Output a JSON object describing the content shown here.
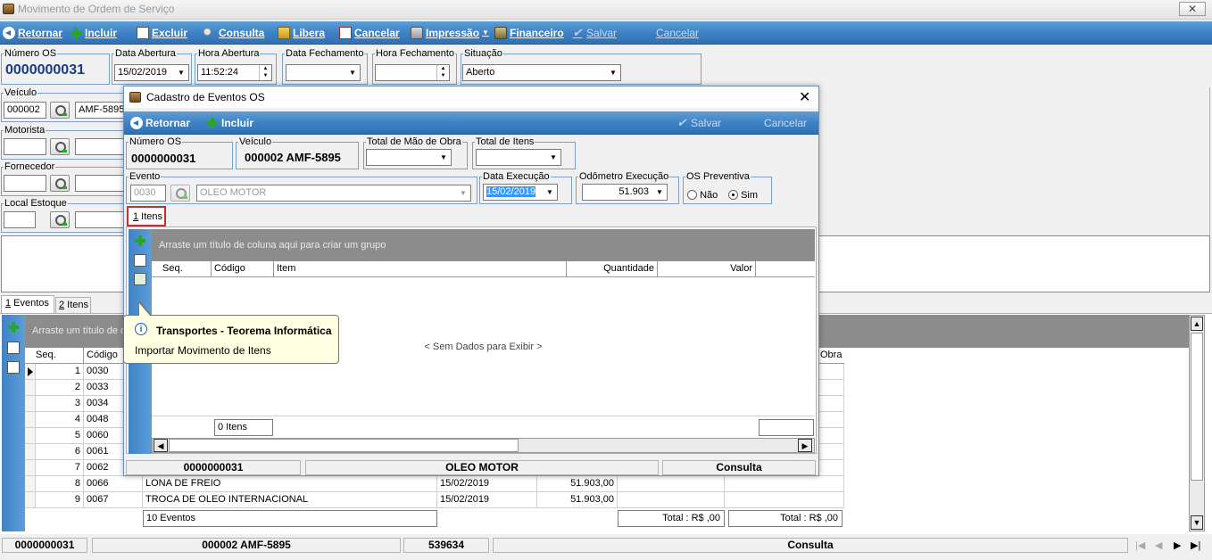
{
  "main_window": {
    "title": "Movimento de Ordem de Serviço",
    "close": "✕",
    "toolbar": {
      "retornar": "Retornar",
      "incluir": "Incluir",
      "excluir": "Excluir",
      "consulta": "Consulta",
      "libera": "Libera",
      "cancelar": "Cancelar",
      "impressao": "Impressão",
      "financeiro": "Financeiro",
      "salvar": "Salvar",
      "cancelar2": "Cancelar"
    },
    "fields": {
      "numero_os_label": "Número OS",
      "numero_os": "0000000031",
      "data_abertura_label": "Data Abertura",
      "data_abertura": "15/02/2019",
      "hora_abertura_label": "Hora Abertura",
      "hora_abertura": "11:52:24",
      "data_fechamento_label": "Data Fechamento",
      "data_fechamento": "",
      "hora_fechamento_label": "Hora Fechamento",
      "hora_fechamento": "",
      "situacao_label": "Situação",
      "situacao": "Aberto",
      "veiculo_label": "Veículo",
      "veiculo_codigo": "000002",
      "veiculo_placa": "AMF-5895",
      "motorista_label": "Motorista",
      "fornecedor_label": "Fornecedor",
      "local_estoque_label": "Local Estoque"
    },
    "tabs": [
      {
        "num": "1",
        "label": " Eventos"
      },
      {
        "num": "2",
        "label": " Itens"
      }
    ],
    "grid": {
      "group_hint": "Arraste um título de c",
      "columns": [
        "Seq.",
        "Código",
        "Obra"
      ],
      "rows": [
        {
          "seq": "1",
          "codigo": "0030",
          "desc": "",
          "data": "",
          "valor": ""
        },
        {
          "seq": "2",
          "codigo": "0033",
          "desc": "",
          "data": "",
          "valor": ""
        },
        {
          "seq": "3",
          "codigo": "0034",
          "desc": "",
          "data": "",
          "valor": ""
        },
        {
          "seq": "4",
          "codigo": "0048",
          "desc": "",
          "data": "",
          "valor": ""
        },
        {
          "seq": "5",
          "codigo": "0060",
          "desc": "",
          "data": "",
          "valor": ""
        },
        {
          "seq": "6",
          "codigo": "0061",
          "desc": "",
          "data": "",
          "valor": ""
        },
        {
          "seq": "7",
          "codigo": "0062",
          "desc": "",
          "data": "",
          "valor": ""
        },
        {
          "seq": "8",
          "codigo": "0066",
          "desc": "LONA DE FREIO",
          "data": "15/02/2019",
          "valor": "51.903,00"
        },
        {
          "seq": "9",
          "codigo": "0067",
          "desc": "TROCA DE OLEO INTERNACIONAL",
          "data": "15/02/2019",
          "valor": "51.903,00"
        }
      ],
      "footer_count": "10 Eventos",
      "footer_total1": "Total : R$ ,00",
      "footer_total2": "Total : R$ ,00"
    },
    "statusbar": {
      "numero": "0000000031",
      "veiculo": "000002 AMF-5895",
      "odometro": "539634",
      "modo": "Consulta"
    }
  },
  "dialog": {
    "title": "Cadastro de Eventos OS",
    "close": "✕",
    "toolbar": {
      "retornar": "Retornar",
      "incluir": "Incluir",
      "salvar": "Salvar",
      "cancelar": "Cancelar"
    },
    "fields": {
      "numero_os_label": "Número OS",
      "numero_os": "0000000031",
      "veiculo_label": "Veículo",
      "veiculo": "000002 AMF-5895",
      "total_mao_obra_label": "Total de Mão de Obra",
      "total_mao_obra": "",
      "total_itens_label": "Total de Itens",
      "total_itens": "",
      "evento_label": "Evento",
      "evento_codigo": "0030",
      "evento_desc": "OLEO MOTOR",
      "data_execucao_label": "Data Execução",
      "data_execucao": "15/02/2019",
      "odometro_label": "Odômetro Execução",
      "odometro": "51.903",
      "os_preventiva_label": "OS Preventiva",
      "nao": "Não",
      "sim": "Sim"
    },
    "tab": {
      "num": "1",
      "label": " Itens"
    },
    "grid": {
      "group_hint": "Arraste um título de coluna aqui para criar um grupo",
      "columns": [
        "Seq.",
        "Código",
        "Item",
        "Quantidade",
        "Valor"
      ],
      "empty": "< Sem Dados para Exibir >",
      "footer_count": "0 Itens"
    },
    "statusbar": {
      "numero": "0000000031",
      "evento": "OLEO MOTOR",
      "modo": "Consulta"
    },
    "tooltip": {
      "title": "Transportes - Teorema Informática",
      "text": "Importar Movimento de Itens"
    }
  },
  "colors": {
    "toolbar_blue": "#3f83c6",
    "side_blue": "#3f83c6",
    "selection_blue": "#3399ff",
    "tab_highlight": "#d9262b"
  }
}
